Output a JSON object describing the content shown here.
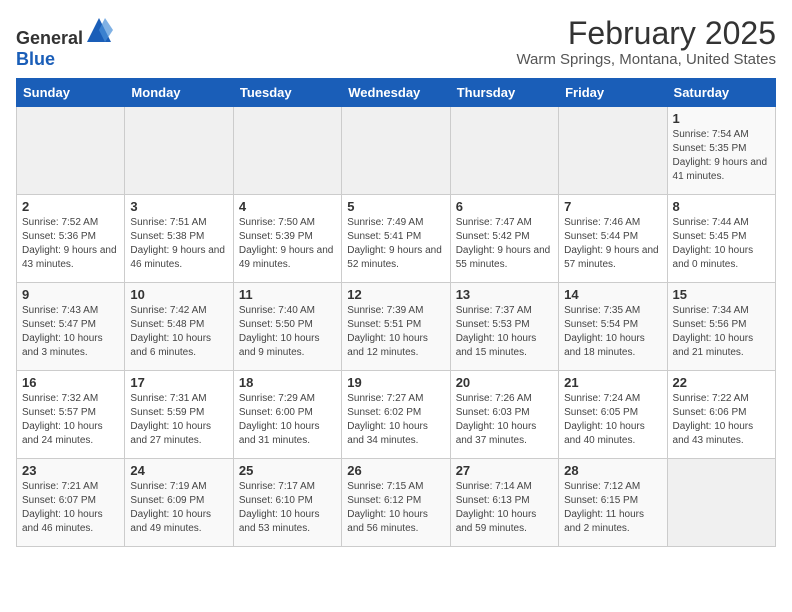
{
  "logo": {
    "text_general": "General",
    "text_blue": "Blue"
  },
  "calendar": {
    "title": "February 2025",
    "subtitle": "Warm Springs, Montana, United States"
  },
  "headers": [
    "Sunday",
    "Monday",
    "Tuesday",
    "Wednesday",
    "Thursday",
    "Friday",
    "Saturday"
  ],
  "weeks": [
    [
      {
        "day": "",
        "info": ""
      },
      {
        "day": "",
        "info": ""
      },
      {
        "day": "",
        "info": ""
      },
      {
        "day": "",
        "info": ""
      },
      {
        "day": "",
        "info": ""
      },
      {
        "day": "",
        "info": ""
      },
      {
        "day": "1",
        "info": "Sunrise: 7:54 AM\nSunset: 5:35 PM\nDaylight: 9 hours and 41 minutes."
      }
    ],
    [
      {
        "day": "2",
        "info": "Sunrise: 7:52 AM\nSunset: 5:36 PM\nDaylight: 9 hours and 43 minutes."
      },
      {
        "day": "3",
        "info": "Sunrise: 7:51 AM\nSunset: 5:38 PM\nDaylight: 9 hours and 46 minutes."
      },
      {
        "day": "4",
        "info": "Sunrise: 7:50 AM\nSunset: 5:39 PM\nDaylight: 9 hours and 49 minutes."
      },
      {
        "day": "5",
        "info": "Sunrise: 7:49 AM\nSunset: 5:41 PM\nDaylight: 9 hours and 52 minutes."
      },
      {
        "day": "6",
        "info": "Sunrise: 7:47 AM\nSunset: 5:42 PM\nDaylight: 9 hours and 55 minutes."
      },
      {
        "day": "7",
        "info": "Sunrise: 7:46 AM\nSunset: 5:44 PM\nDaylight: 9 hours and 57 minutes."
      },
      {
        "day": "8",
        "info": "Sunrise: 7:44 AM\nSunset: 5:45 PM\nDaylight: 10 hours and 0 minutes."
      }
    ],
    [
      {
        "day": "9",
        "info": "Sunrise: 7:43 AM\nSunset: 5:47 PM\nDaylight: 10 hours and 3 minutes."
      },
      {
        "day": "10",
        "info": "Sunrise: 7:42 AM\nSunset: 5:48 PM\nDaylight: 10 hours and 6 minutes."
      },
      {
        "day": "11",
        "info": "Sunrise: 7:40 AM\nSunset: 5:50 PM\nDaylight: 10 hours and 9 minutes."
      },
      {
        "day": "12",
        "info": "Sunrise: 7:39 AM\nSunset: 5:51 PM\nDaylight: 10 hours and 12 minutes."
      },
      {
        "day": "13",
        "info": "Sunrise: 7:37 AM\nSunset: 5:53 PM\nDaylight: 10 hours and 15 minutes."
      },
      {
        "day": "14",
        "info": "Sunrise: 7:35 AM\nSunset: 5:54 PM\nDaylight: 10 hours and 18 minutes."
      },
      {
        "day": "15",
        "info": "Sunrise: 7:34 AM\nSunset: 5:56 PM\nDaylight: 10 hours and 21 minutes."
      }
    ],
    [
      {
        "day": "16",
        "info": "Sunrise: 7:32 AM\nSunset: 5:57 PM\nDaylight: 10 hours and 24 minutes."
      },
      {
        "day": "17",
        "info": "Sunrise: 7:31 AM\nSunset: 5:59 PM\nDaylight: 10 hours and 27 minutes."
      },
      {
        "day": "18",
        "info": "Sunrise: 7:29 AM\nSunset: 6:00 PM\nDaylight: 10 hours and 31 minutes."
      },
      {
        "day": "19",
        "info": "Sunrise: 7:27 AM\nSunset: 6:02 PM\nDaylight: 10 hours and 34 minutes."
      },
      {
        "day": "20",
        "info": "Sunrise: 7:26 AM\nSunset: 6:03 PM\nDaylight: 10 hours and 37 minutes."
      },
      {
        "day": "21",
        "info": "Sunrise: 7:24 AM\nSunset: 6:05 PM\nDaylight: 10 hours and 40 minutes."
      },
      {
        "day": "22",
        "info": "Sunrise: 7:22 AM\nSunset: 6:06 PM\nDaylight: 10 hours and 43 minutes."
      }
    ],
    [
      {
        "day": "23",
        "info": "Sunrise: 7:21 AM\nSunset: 6:07 PM\nDaylight: 10 hours and 46 minutes."
      },
      {
        "day": "24",
        "info": "Sunrise: 7:19 AM\nSunset: 6:09 PM\nDaylight: 10 hours and 49 minutes."
      },
      {
        "day": "25",
        "info": "Sunrise: 7:17 AM\nSunset: 6:10 PM\nDaylight: 10 hours and 53 minutes."
      },
      {
        "day": "26",
        "info": "Sunrise: 7:15 AM\nSunset: 6:12 PM\nDaylight: 10 hours and 56 minutes."
      },
      {
        "day": "27",
        "info": "Sunrise: 7:14 AM\nSunset: 6:13 PM\nDaylight: 10 hours and 59 minutes."
      },
      {
        "day": "28",
        "info": "Sunrise: 7:12 AM\nSunset: 6:15 PM\nDaylight: 11 hours and 2 minutes."
      },
      {
        "day": "",
        "info": ""
      }
    ]
  ]
}
